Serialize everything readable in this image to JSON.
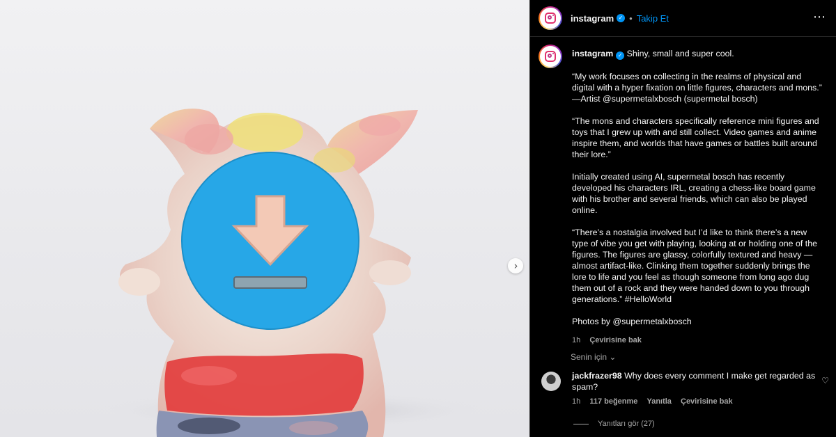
{
  "media": {
    "next_icon": "chevron-right-icon",
    "overlay_icon": "download-icon",
    "colors": {
      "overlay": "#27a7e7",
      "figure_pink": "#f0b8b0",
      "figure_yellow": "#efe07a",
      "figure_red": "#e23b3b"
    }
  },
  "header": {
    "username": "instagram",
    "separator": "•",
    "follow_label": "Takip Et",
    "more_icon": "more-horizontal-icon",
    "more_glyph": "⋯"
  },
  "caption": {
    "username": "instagram",
    "first_line": "Shiny, small and super cool.",
    "paragraphs": [
      "“My work focuses on collecting in the realms of physical and digital with a hyper fixation on little figures, characters and mons.” —Artist @supermetalxbosch (supermetal bosch)",
      "“The mons and characters specifically reference mini figures and toys that I grew up with and still collect. Video games and anime inspire them, and worlds that have games or battles built around their lore.”",
      "Initially created using AI, supermetal bosch has recently developed his characters IRL, creating a chess-like board game with his brother and several friends, which can also be played online.",
      "“There’s a nostalgia involved but I’d like to think there’s a new type of vibe you get with playing, looking at or holding one of the figures. The figures are glassy, colorfully textured and heavy — almost artifact-like. Clinking them together suddenly brings the lore to life and you feel as though someone from long ago dug them out of a rock and they were handed down to you through generations.” #HelloWorld",
      "Photos by @supermetalxbosch"
    ],
    "time": "1h",
    "translate_label": "Çevirisine bak"
  },
  "for_you": {
    "label": "Senin için",
    "chevron": "⌄"
  },
  "comment": {
    "username": "jackfrazer98",
    "text": "Why does every comment I make get regarded as spam?",
    "time": "1h",
    "likes": "117 beğenme",
    "reply_label": "Yanıtla",
    "translate_label": "Çevirisine bak",
    "heart_icon": "heart-icon",
    "heart_glyph": "♡"
  },
  "replies": {
    "label": "Yanıtları gör (27)"
  }
}
